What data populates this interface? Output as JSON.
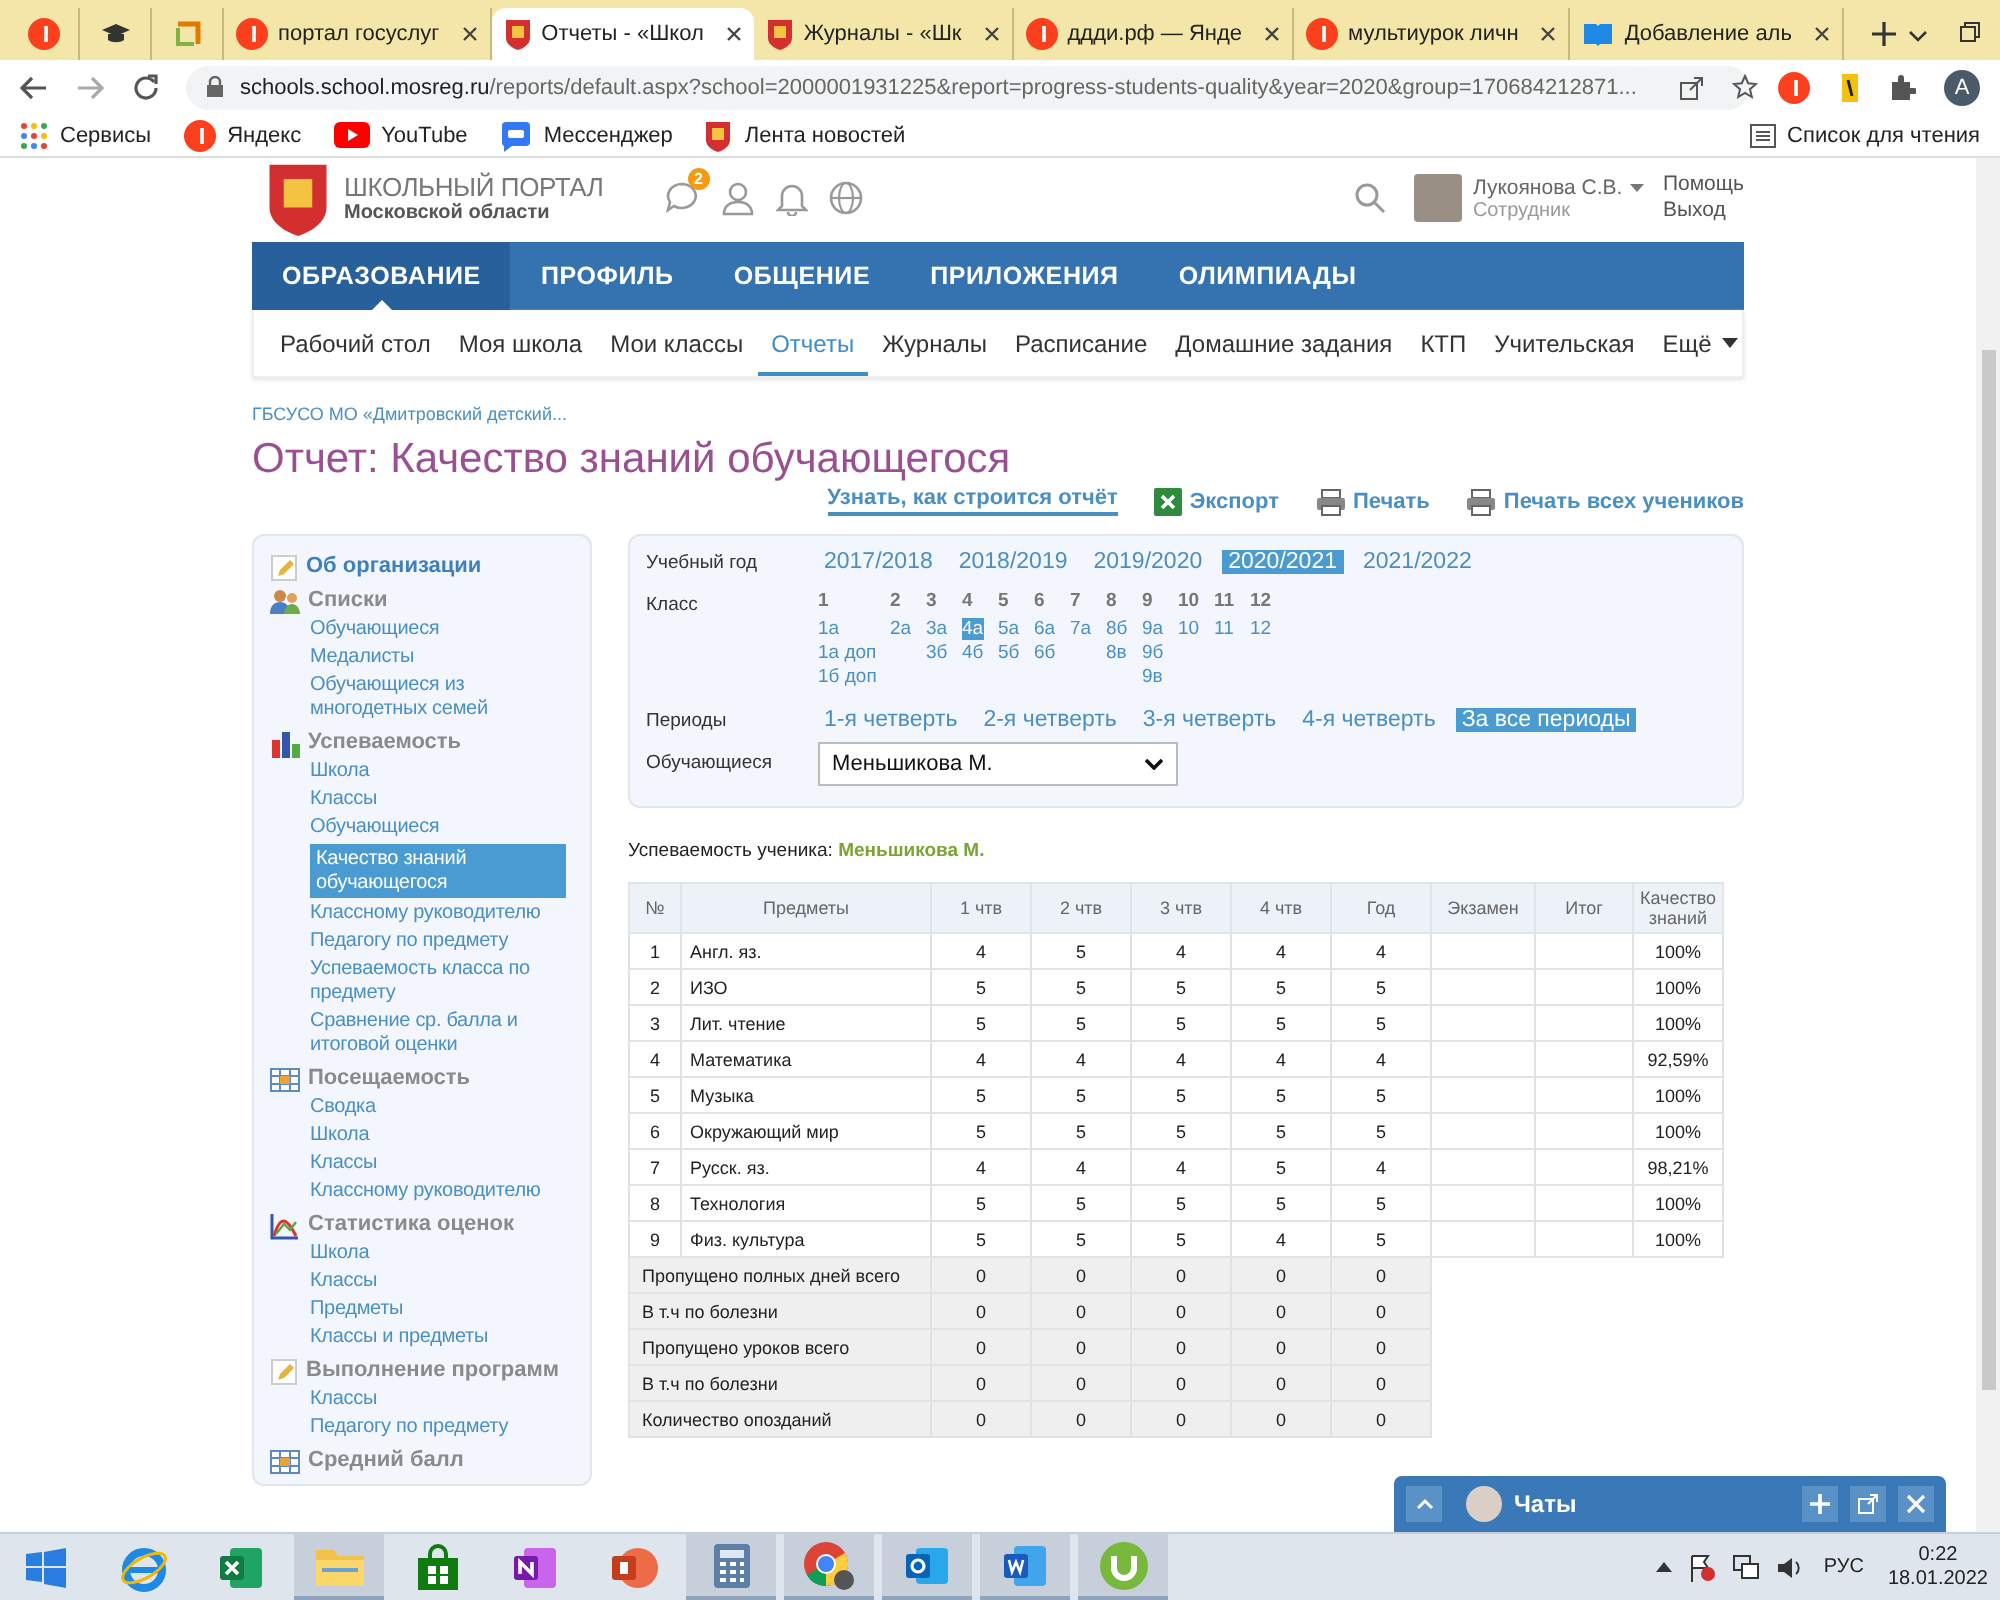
{
  "browser": {
    "tabs": [
      {
        "kind": "yandex",
        "selected": false
      },
      {
        "kind": "cap",
        "selected": false
      },
      {
        "kind": "frame",
        "selected": false
      },
      {
        "kind": "yandex",
        "label": "портал госуслуг",
        "selected": false
      },
      {
        "kind": "emblem",
        "label": "Отчеты - «Школ",
        "selected": true
      },
      {
        "kind": "emblem",
        "label": "Журналы - «Шк",
        "selected": false
      },
      {
        "kind": "yandex",
        "label": "ддди.рф — Янде",
        "selected": false
      },
      {
        "kind": "yandex",
        "label": "мультиурок личн",
        "selected": false
      },
      {
        "kind": "book",
        "label": "Добавление аль",
        "selected": false
      }
    ],
    "url_host": "schools.school.mosreg.ru",
    "url_rest": "/reports/default.aspx?school=2000001931225&report=progress-students-quality&year=2020&group=170684212871...",
    "profile_initial": "A",
    "bookmarks": [
      {
        "kind": "apps",
        "label": "Сервисы"
      },
      {
        "kind": "yandex",
        "label": "Яндекс"
      },
      {
        "kind": "youtube",
        "label": "YouTube"
      },
      {
        "kind": "messenger",
        "label": "Мессенджер"
      },
      {
        "kind": "emblem",
        "label": "Лента новостей"
      }
    ],
    "reading_list": "Список для чтения"
  },
  "header": {
    "portal_title": "ШКОЛЬНЫЙ ПОРТАЛ",
    "portal_region": "Московской области",
    "notification_badge": "2",
    "user_name": "Лукоянова С.В.",
    "user_role": "Сотрудник",
    "links": [
      "Помощь",
      "Выход"
    ]
  },
  "main_nav": [
    {
      "label": "ОБРАЗОВАНИЕ",
      "selected": true
    },
    {
      "label": "ПРОФИЛЬ",
      "selected": false
    },
    {
      "label": "ОБЩЕНИЕ",
      "selected": false
    },
    {
      "label": "ПРИЛОЖЕНИЯ",
      "selected": false
    },
    {
      "label": "ОЛИМПИАДЫ",
      "selected": false
    }
  ],
  "sub_nav": [
    {
      "label": "Рабочий стол",
      "selected": false
    },
    {
      "label": "Моя школа",
      "selected": false
    },
    {
      "label": "Мои классы",
      "selected": false
    },
    {
      "label": "Отчеты",
      "selected": true
    },
    {
      "label": "Журналы",
      "selected": false
    },
    {
      "label": "Расписание",
      "selected": false
    },
    {
      "label": "Домашние задания",
      "selected": false
    },
    {
      "label": "КТП",
      "selected": false
    },
    {
      "label": "Учительская",
      "selected": false
    }
  ],
  "sub_nav_more": "Ещё",
  "breadcrumb": "ГБСУСО МО «Дмитровский детский...",
  "title": "Отчет: Качество знаний обучающегося",
  "actions": [
    {
      "kind": "link",
      "label": "Узнать, как строится отчёт"
    },
    {
      "kind": "excel",
      "label": "Экспорт"
    },
    {
      "kind": "printer",
      "label": "Печать"
    },
    {
      "kind": "printer",
      "label": "Печать всех учеников"
    }
  ],
  "sidebar": {
    "sections": [
      {
        "title": "Об организации",
        "kind": "pencil"
      },
      {
        "title": "Списки",
        "kind": "people",
        "children": [
          {
            "label": "Обучающиеся",
            "selected": false
          },
          {
            "label": "Медалисты",
            "selected": false
          },
          {
            "label": "Обучающиеся из многодетных семей",
            "selected": false
          }
        ]
      },
      {
        "title": "Успеваемость",
        "kind": "bars",
        "children": [
          {
            "label": "Школа",
            "selected": false
          },
          {
            "label": "Классы",
            "selected": false
          },
          {
            "label": "Обучающиеся",
            "selected": false
          },
          {
            "label": "Качество знаний обучающегося",
            "selected": true
          },
          {
            "label": "Классному руководителю",
            "selected": false
          },
          {
            "label": "Педагогу по предмету",
            "selected": false
          },
          {
            "label": "Успеваемость класса по предмету",
            "selected": false
          },
          {
            "label": "Сравнение ср. балла и итоговой оценки",
            "selected": false
          }
        ]
      },
      {
        "title": "Посещаемость",
        "kind": "grid",
        "children": [
          {
            "label": "Сводка",
            "selected": false
          },
          {
            "label": "Школа",
            "selected": false
          },
          {
            "label": "Классы",
            "selected": false
          },
          {
            "label": "Классному руководителю",
            "selected": false
          }
        ]
      },
      {
        "title": "Статистика оценок",
        "kind": "stats",
        "children": [
          {
            "label": "Школа",
            "selected": false
          },
          {
            "label": "Классы",
            "selected": false
          },
          {
            "label": "Предметы",
            "selected": false
          },
          {
            "label": "Классы и предметы",
            "selected": false
          }
        ]
      },
      {
        "title": "Выполнение программ",
        "kind": "pencil",
        "children": [
          {
            "label": "Классы",
            "selected": false
          },
          {
            "label": "Педагогу по предмету",
            "selected": false
          }
        ]
      },
      {
        "title": "Средний балл",
        "kind": "grid"
      }
    ]
  },
  "filters": {
    "year": {
      "label": "Учебный год",
      "options": [
        {
          "label": "2017/2018",
          "selected": false
        },
        {
          "label": "2018/2019",
          "selected": false
        },
        {
          "label": "2019/2020",
          "selected": false
        },
        {
          "label": "2020/2021",
          "selected": true
        },
        {
          "label": "2021/2022",
          "selected": false
        }
      ]
    },
    "class": {
      "label": "Класс",
      "grades": [
        {
          "grade": "1",
          "groups": [
            {
              "label": "1а",
              "selected": false
            },
            {
              "label": "1а доп",
              "selected": false
            },
            {
              "label": "1б доп",
              "selected": false
            }
          ]
        },
        {
          "grade": "2",
          "groups": [
            {
              "label": "2а",
              "selected": false
            }
          ]
        },
        {
          "grade": "3",
          "groups": [
            {
              "label": "3а",
              "selected": false
            },
            {
              "label": "3б",
              "selected": false
            }
          ]
        },
        {
          "grade": "4",
          "groups": [
            {
              "label": "4а",
              "selected": true
            },
            {
              "label": "4б",
              "selected": false
            }
          ]
        },
        {
          "grade": "5",
          "groups": [
            {
              "label": "5а",
              "selected": false
            },
            {
              "label": "5б",
              "selected": false
            }
          ]
        },
        {
          "grade": "6",
          "groups": [
            {
              "label": "6а",
              "selected": false
            },
            {
              "label": "6б",
              "selected": false
            }
          ]
        },
        {
          "grade": "7",
          "groups": [
            {
              "label": "7а",
              "selected": false
            }
          ]
        },
        {
          "grade": "8",
          "groups": [
            {
              "label": "8б",
              "selected": false
            },
            {
              "label": "8в",
              "selected": false
            }
          ]
        },
        {
          "grade": "9",
          "groups": [
            {
              "label": "9а",
              "selected": false
            },
            {
              "label": "9б",
              "selected": false
            },
            {
              "label": "9в",
              "selected": false
            }
          ]
        },
        {
          "grade": "10",
          "groups": [
            {
              "label": "10",
              "selected": false
            }
          ]
        },
        {
          "grade": "11",
          "groups": [
            {
              "label": "11",
              "selected": false
            }
          ]
        },
        {
          "grade": "12",
          "groups": [
            {
              "label": "12",
              "selected": false
            }
          ]
        }
      ]
    },
    "periods": {
      "label": "Периоды",
      "options": [
        {
          "label": "1-я четверть",
          "selected": false
        },
        {
          "label": "2-я четверть",
          "selected": false
        },
        {
          "label": "3-я четверть",
          "selected": false
        },
        {
          "label": "4-я четверть",
          "selected": false
        },
        {
          "label": "За все периоды",
          "selected": true
        }
      ]
    },
    "student": {
      "label": "Обучающиеся",
      "value": "Меньшикова М."
    }
  },
  "report": {
    "caption": "Успеваемость ученика:",
    "student": "Меньшикова М.",
    "columns": [
      "№",
      "Предметы",
      "1 чтв",
      "2 чтв",
      "3 чтв",
      "4 чтв",
      "Год",
      "Экзамен",
      "Итог",
      "Качество знаний"
    ],
    "rows": [
      {
        "num": "1",
        "subject": "Англ. яз.",
        "marks": [
          "4",
          "5",
          "4",
          "4",
          "4"
        ],
        "quality": "100%"
      },
      {
        "num": "2",
        "subject": "ИЗО",
        "marks": [
          "5",
          "5",
          "5",
          "5",
          "5"
        ],
        "quality": "100%"
      },
      {
        "num": "3",
        "subject": "Лит. чтение",
        "marks": [
          "5",
          "5",
          "5",
          "5",
          "5"
        ],
        "quality": "100%"
      },
      {
        "num": "4",
        "subject": "Математика",
        "marks": [
          "4",
          "4",
          "4",
          "4",
          "4"
        ],
        "quality": "92,59%"
      },
      {
        "num": "5",
        "subject": "Музыка",
        "marks": [
          "5",
          "5",
          "5",
          "5",
          "5"
        ],
        "quality": "100%"
      },
      {
        "num": "6",
        "subject": "Окружающий мир",
        "marks": [
          "5",
          "5",
          "5",
          "5",
          "5"
        ],
        "quality": "100%"
      },
      {
        "num": "7",
        "subject": "Русск. яз.",
        "marks": [
          "4",
          "4",
          "4",
          "5",
          "4"
        ],
        "quality": "98,21%"
      },
      {
        "num": "8",
        "subject": "Технология",
        "marks": [
          "5",
          "5",
          "5",
          "5",
          "5"
        ],
        "quality": "100%"
      },
      {
        "num": "9",
        "subject": "Физ. культура",
        "marks": [
          "5",
          "5",
          "5",
          "4",
          "5"
        ],
        "quality": "100%"
      }
    ],
    "summary_rows": [
      {
        "label": "Пропущено полных дней всего",
        "values": [
          "0",
          "0",
          "0",
          "0",
          "0"
        ]
      },
      {
        "label": "В т.ч по болезни",
        "values": [
          "0",
          "0",
          "0",
          "0",
          "0"
        ]
      },
      {
        "label": "Пропущено уроков всего",
        "values": [
          "0",
          "0",
          "0",
          "0",
          "0"
        ]
      },
      {
        "label": "В т.ч по болезни",
        "values": [
          "0",
          "0",
          "0",
          "0",
          "0"
        ]
      },
      {
        "label": "Количество опозданий",
        "values": [
          "0",
          "0",
          "0",
          "0",
          "0"
        ]
      }
    ]
  },
  "chat": {
    "title": "Чаты"
  },
  "taskbar": {
    "apps": [
      {
        "kind": "ie",
        "running": false
      },
      {
        "kind": "excel",
        "running": false
      },
      {
        "kind": "folder",
        "running": true
      },
      {
        "kind": "store",
        "running": false
      },
      {
        "kind": "onenote",
        "running": false
      },
      {
        "kind": "powerpoint",
        "running": false
      },
      {
        "kind": "calculator",
        "running": true
      },
      {
        "kind": "chrome",
        "running": true
      },
      {
        "kind": "outlook",
        "running": true
      },
      {
        "kind": "word",
        "running": true
      },
      {
        "kind": "utorrent",
        "running": true
      }
    ],
    "language": "РУС",
    "time": "0:22",
    "date": "18.01.2022"
  }
}
